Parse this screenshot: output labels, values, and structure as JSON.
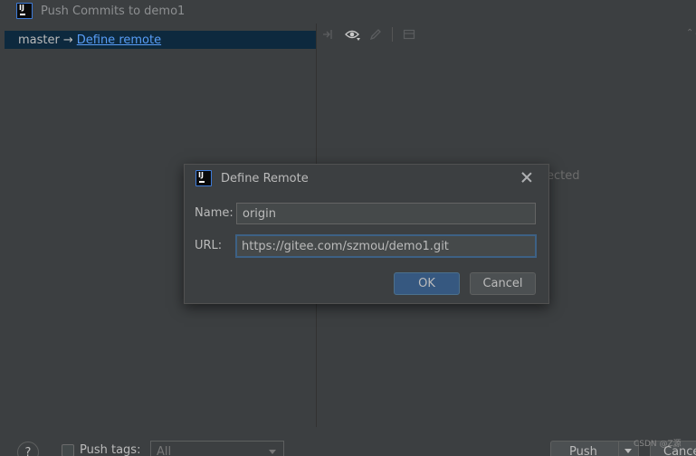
{
  "window": {
    "title": "Push Commits to demo1"
  },
  "branch": {
    "name": "master",
    "arrow": "→",
    "remote_link": "Define remote"
  },
  "right_panel": {
    "empty_text_fragment": "ected",
    "sort_glyph": "⌃⌄"
  },
  "footer": {
    "help_label": "?",
    "push_tags_label": "Push tags:",
    "tags_value": "All",
    "push_label": "Push",
    "cancel_label": "Cance",
    "watermark": "CSDN @Z源"
  },
  "dialog": {
    "title": "Define Remote",
    "name_label": "Name:",
    "name_value": "origin",
    "url_label": "URL:",
    "url_value": "https://gitee.com/szmou/demo1.git",
    "ok_label": "OK",
    "cancel_label": "Cancel"
  },
  "logo": {
    "letters": "IJ"
  },
  "colors": {
    "background": "#3c3f41",
    "selection": "#0d293e",
    "link": "#589df6",
    "ok_button": "#365880",
    "focus_border": "#3d6185"
  },
  "icons": [
    "intellij-logo",
    "arrow-merge-icon",
    "eye-icon",
    "edit-icon",
    "layout-icon",
    "close-icon"
  ]
}
